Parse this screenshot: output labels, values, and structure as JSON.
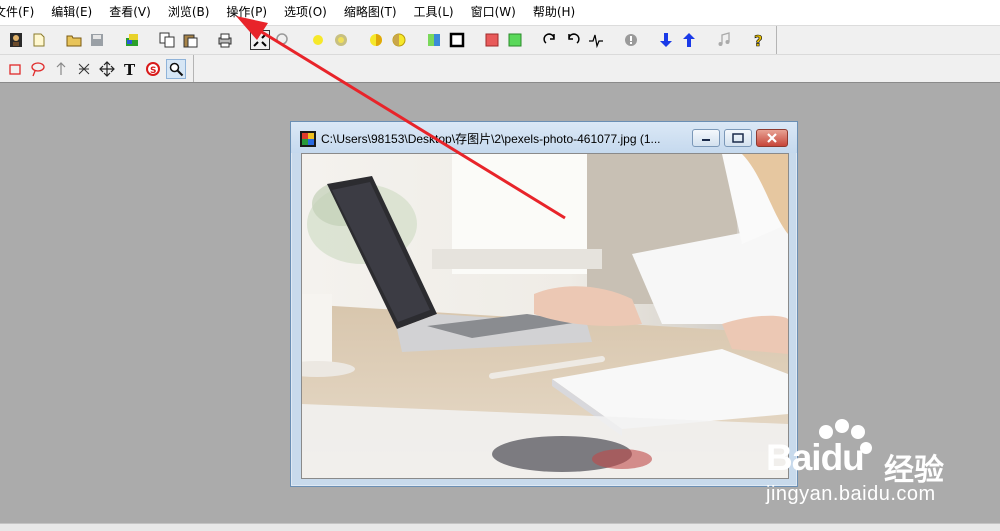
{
  "menubar": {
    "items": [
      "文件(F)",
      "编辑(E)",
      "查看(V)",
      "浏览(B)",
      "操作(P)",
      "选项(O)",
      "缩略图(T)",
      "工具(L)",
      "窗口(W)",
      "帮助(H)"
    ]
  },
  "toolbar_main": {
    "icons": [
      "open-thumbnails-icon",
      "new-icon",
      "open-folder-icon",
      "save-icon",
      "scan-icon",
      "copy-icon",
      "paste-icon",
      "print-icon",
      "fit-screen-icon",
      "zoom-icon",
      "brightness-up-icon",
      "brightness-down-icon",
      "contrast-up-icon",
      "contrast-down-icon",
      "color-icon",
      "frame-icon",
      "red-fill-icon",
      "green-fill-icon",
      "rotate-right-icon",
      "rotate-left-icon",
      "effects-icon",
      "info-icon",
      "next-icon",
      "previous-icon",
      "music-icon",
      "help-icon"
    ]
  },
  "toolbar_tools": {
    "icons": [
      "rect-select-icon",
      "lasso-icon",
      "arrow-tool-icon",
      "crop-icon",
      "move-icon",
      "text-tool-icon",
      "no-sign-icon",
      "magnifier-icon"
    ]
  },
  "image_window": {
    "title": "C:\\Users\\98153\\Desktop\\存图片\\2\\pexels-photo-461077.jpg (1..."
  },
  "watermark": {
    "brand": "Bai",
    "brand2": "du",
    "product": "经验",
    "url": "jingyan.baidu.com"
  },
  "colors": {
    "arrow": "#e8242a",
    "workspace": "#ababab"
  }
}
